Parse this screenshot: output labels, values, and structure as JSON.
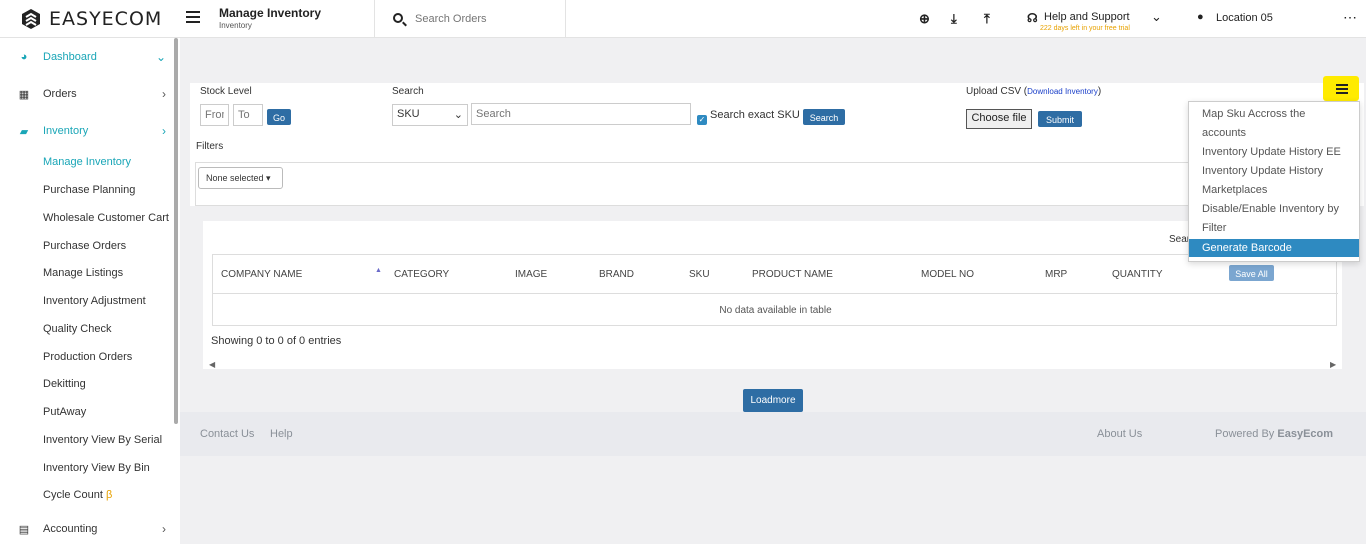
{
  "app": {
    "logo_text": "EASYECOM"
  },
  "header": {
    "page_title": "Manage Inventory",
    "page_subtitle": "Inventory",
    "search_placeholder": "Search Orders",
    "help_label": "Help and Support",
    "help_sub": "222 days left in your free trial",
    "location": "Location 05"
  },
  "sidebar": {
    "dashboard": "Dashboard",
    "orders": "Orders",
    "inventory": "Inventory",
    "sub": [
      "Manage Inventory",
      "Purchase Planning",
      "Wholesale Customer Cart",
      "Purchase Orders",
      "Manage Listings",
      "Inventory Adjustment",
      "Quality Check",
      "Production Orders",
      "Dekitting",
      "PutAway",
      "Inventory View By Serial",
      "Inventory View By Bin",
      "Cycle Count"
    ],
    "beta": "β",
    "accounting": "Accounting"
  },
  "form": {
    "stock_level": "Stock Level",
    "from_placeholder": "From",
    "to_placeholder": "To",
    "go": "Go",
    "search_label": "Search",
    "search_type": "SKU",
    "search_placeholder": "Search",
    "exact_sku": "Search exact SKU",
    "search_btn": "Search",
    "upload_csv": "Upload CSV (",
    "download_inventory": "Download Inventory",
    "upload_close": ")",
    "choose_file": "Choose file",
    "submit": "Submit",
    "filters": "Filters",
    "none_selected": "None selected ▾"
  },
  "table": {
    "search_cut": "Sear",
    "headers": [
      "COMPANY NAME",
      "CATEGORY",
      "IMAGE",
      "BRAND",
      "SKU",
      "PRODUCT NAME",
      "MODEL NO",
      "MRP",
      "QUANTITY"
    ],
    "save_all": "Save All",
    "no_data": "No data available in table",
    "showing": "Showing 0 to 0 of 0 entries",
    "loadmore": "Loadmore"
  },
  "menu": {
    "items": [
      "Map Sku Accross the accounts",
      "Inventory Update History EE",
      "Inventory Update History Marketplaces",
      "Disable/Enable Inventory by Filter"
    ],
    "active": "Generate Barcode"
  },
  "footer": {
    "contact": "Contact Us",
    "help": "Help",
    "about": "About Us",
    "powered": "Powered By ",
    "powered_brand": "EasyEcom"
  },
  "colors": {
    "accent": "#2e8ac1",
    "button": "#2e6da4",
    "teal": "#1aa6b7",
    "highlight": "#ffeb00",
    "beta": "#e8a200"
  }
}
